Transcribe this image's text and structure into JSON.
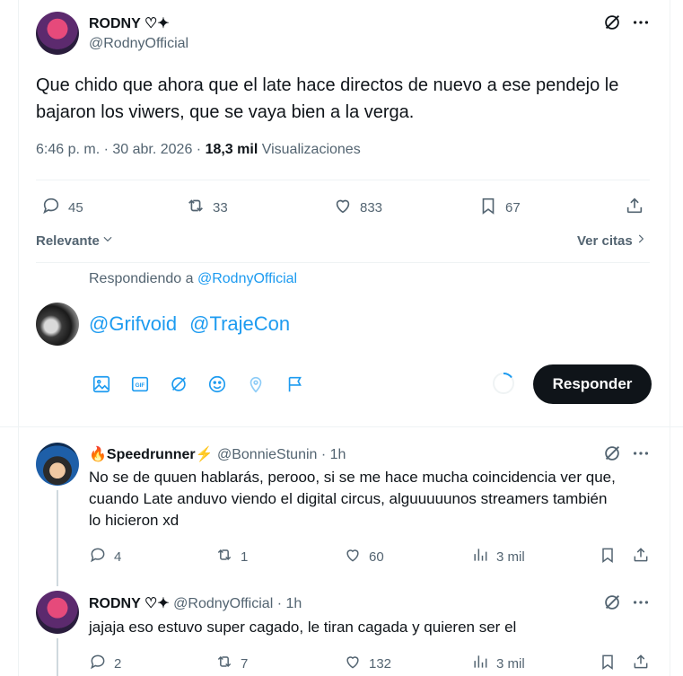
{
  "main_tweet": {
    "name": "RODNY ♡✦",
    "handle": "@RodnyOfficial",
    "text_line1": "Que chido que ahora que el late hace directos de nuevo a ese pendejo le",
    "text_line2": "bajaron los viwers, que se vaya bien a la verga.",
    "time": "6:46 p. m. · 30 abr. 2026 · ",
    "views_count": "18,3 mil",
    "views_label": " Visualizaciones",
    "replies": "45",
    "retweets": "33",
    "likes": "833",
    "bookmarks": "67"
  },
  "sort": {
    "label": "Relevante",
    "quotes_label": "Ver citas"
  },
  "composer": {
    "replying_to_prefix": "Respondiendo a ",
    "replying_to_handle": "@RodnyOfficial",
    "mention1": "@Grifvoid",
    "mention2": "@TrajeCon",
    "reply_button": "Responder"
  },
  "replies": [
    {
      "emoji": "🔥",
      "name": "Speedrunner",
      "badge": "⚡",
      "handle": "@BonnieStunin",
      "time": " · 1h",
      "line1": "No se de quuen hablarás, perooo, si se me hace mucha coincidencia ver que,",
      "line2": "cuando Late anduvo viendo el digital circus, alguuuuunos streamers también",
      "line3": "lo hicieron xd",
      "replies": "4",
      "retweets": "1",
      "likes": "60",
      "views": "3 mil"
    },
    {
      "name": "RODNY ♡✦",
      "handle": "@RodnyOfficial",
      "time": " · 1h",
      "line1": "jajaja eso estuvo super cagado, le tiran cagada y quieren ser el",
      "replies": "2",
      "retweets": "7",
      "likes": "132",
      "views": "3 mil"
    }
  ],
  "icons": [
    "grok-icon",
    "more-icon",
    "reply-icon",
    "retweet-icon",
    "like-icon",
    "bookmark-icon",
    "share-icon",
    "views-icon",
    "image-icon",
    "gif-icon",
    "emoji-icon",
    "location-icon",
    "schedule-icon"
  ],
  "colors": {
    "accent": "#1d9bf0",
    "text": "#0f1419",
    "secondary": "#536471",
    "button": "#0f1419"
  }
}
